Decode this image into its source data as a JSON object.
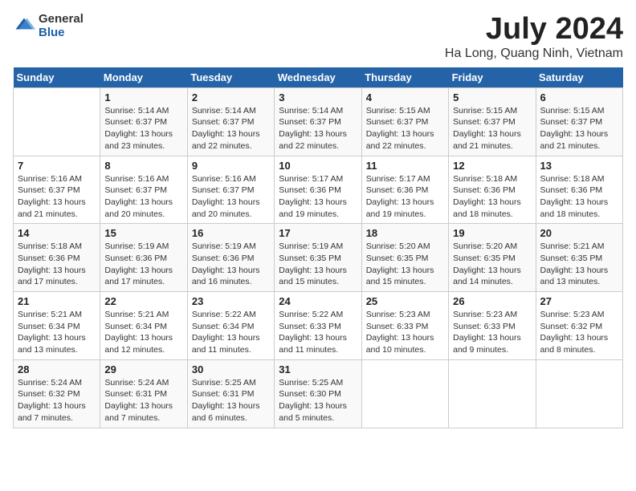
{
  "header": {
    "logo_general": "General",
    "logo_blue": "Blue",
    "month_title": "July 2024",
    "location": "Ha Long, Quang Ninh, Vietnam"
  },
  "weekdays": [
    "Sunday",
    "Monday",
    "Tuesday",
    "Wednesday",
    "Thursday",
    "Friday",
    "Saturday"
  ],
  "weeks": [
    [
      {
        "day": "",
        "info": ""
      },
      {
        "day": "1",
        "info": "Sunrise: 5:14 AM\nSunset: 6:37 PM\nDaylight: 13 hours\nand 23 minutes."
      },
      {
        "day": "2",
        "info": "Sunrise: 5:14 AM\nSunset: 6:37 PM\nDaylight: 13 hours\nand 22 minutes."
      },
      {
        "day": "3",
        "info": "Sunrise: 5:14 AM\nSunset: 6:37 PM\nDaylight: 13 hours\nand 22 minutes."
      },
      {
        "day": "4",
        "info": "Sunrise: 5:15 AM\nSunset: 6:37 PM\nDaylight: 13 hours\nand 22 minutes."
      },
      {
        "day": "5",
        "info": "Sunrise: 5:15 AM\nSunset: 6:37 PM\nDaylight: 13 hours\nand 21 minutes."
      },
      {
        "day": "6",
        "info": "Sunrise: 5:15 AM\nSunset: 6:37 PM\nDaylight: 13 hours\nand 21 minutes."
      }
    ],
    [
      {
        "day": "7",
        "info": "Sunrise: 5:16 AM\nSunset: 6:37 PM\nDaylight: 13 hours\nand 21 minutes."
      },
      {
        "day": "8",
        "info": "Sunrise: 5:16 AM\nSunset: 6:37 PM\nDaylight: 13 hours\nand 20 minutes."
      },
      {
        "day": "9",
        "info": "Sunrise: 5:16 AM\nSunset: 6:37 PM\nDaylight: 13 hours\nand 20 minutes."
      },
      {
        "day": "10",
        "info": "Sunrise: 5:17 AM\nSunset: 6:36 PM\nDaylight: 13 hours\nand 19 minutes."
      },
      {
        "day": "11",
        "info": "Sunrise: 5:17 AM\nSunset: 6:36 PM\nDaylight: 13 hours\nand 19 minutes."
      },
      {
        "day": "12",
        "info": "Sunrise: 5:18 AM\nSunset: 6:36 PM\nDaylight: 13 hours\nand 18 minutes."
      },
      {
        "day": "13",
        "info": "Sunrise: 5:18 AM\nSunset: 6:36 PM\nDaylight: 13 hours\nand 18 minutes."
      }
    ],
    [
      {
        "day": "14",
        "info": "Sunrise: 5:18 AM\nSunset: 6:36 PM\nDaylight: 13 hours\nand 17 minutes."
      },
      {
        "day": "15",
        "info": "Sunrise: 5:19 AM\nSunset: 6:36 PM\nDaylight: 13 hours\nand 17 minutes."
      },
      {
        "day": "16",
        "info": "Sunrise: 5:19 AM\nSunset: 6:36 PM\nDaylight: 13 hours\nand 16 minutes."
      },
      {
        "day": "17",
        "info": "Sunrise: 5:19 AM\nSunset: 6:35 PM\nDaylight: 13 hours\nand 15 minutes."
      },
      {
        "day": "18",
        "info": "Sunrise: 5:20 AM\nSunset: 6:35 PM\nDaylight: 13 hours\nand 15 minutes."
      },
      {
        "day": "19",
        "info": "Sunrise: 5:20 AM\nSunset: 6:35 PM\nDaylight: 13 hours\nand 14 minutes."
      },
      {
        "day": "20",
        "info": "Sunrise: 5:21 AM\nSunset: 6:35 PM\nDaylight: 13 hours\nand 13 minutes."
      }
    ],
    [
      {
        "day": "21",
        "info": "Sunrise: 5:21 AM\nSunset: 6:34 PM\nDaylight: 13 hours\nand 13 minutes."
      },
      {
        "day": "22",
        "info": "Sunrise: 5:21 AM\nSunset: 6:34 PM\nDaylight: 13 hours\nand 12 minutes."
      },
      {
        "day": "23",
        "info": "Sunrise: 5:22 AM\nSunset: 6:34 PM\nDaylight: 13 hours\nand 11 minutes."
      },
      {
        "day": "24",
        "info": "Sunrise: 5:22 AM\nSunset: 6:33 PM\nDaylight: 13 hours\nand 11 minutes."
      },
      {
        "day": "25",
        "info": "Sunrise: 5:23 AM\nSunset: 6:33 PM\nDaylight: 13 hours\nand 10 minutes."
      },
      {
        "day": "26",
        "info": "Sunrise: 5:23 AM\nSunset: 6:33 PM\nDaylight: 13 hours\nand 9 minutes."
      },
      {
        "day": "27",
        "info": "Sunrise: 5:23 AM\nSunset: 6:32 PM\nDaylight: 13 hours\nand 8 minutes."
      }
    ],
    [
      {
        "day": "28",
        "info": "Sunrise: 5:24 AM\nSunset: 6:32 PM\nDaylight: 13 hours\nand 7 minutes."
      },
      {
        "day": "29",
        "info": "Sunrise: 5:24 AM\nSunset: 6:31 PM\nDaylight: 13 hours\nand 7 minutes."
      },
      {
        "day": "30",
        "info": "Sunrise: 5:25 AM\nSunset: 6:31 PM\nDaylight: 13 hours\nand 6 minutes."
      },
      {
        "day": "31",
        "info": "Sunrise: 5:25 AM\nSunset: 6:30 PM\nDaylight: 13 hours\nand 5 minutes."
      },
      {
        "day": "",
        "info": ""
      },
      {
        "day": "",
        "info": ""
      },
      {
        "day": "",
        "info": ""
      }
    ]
  ]
}
